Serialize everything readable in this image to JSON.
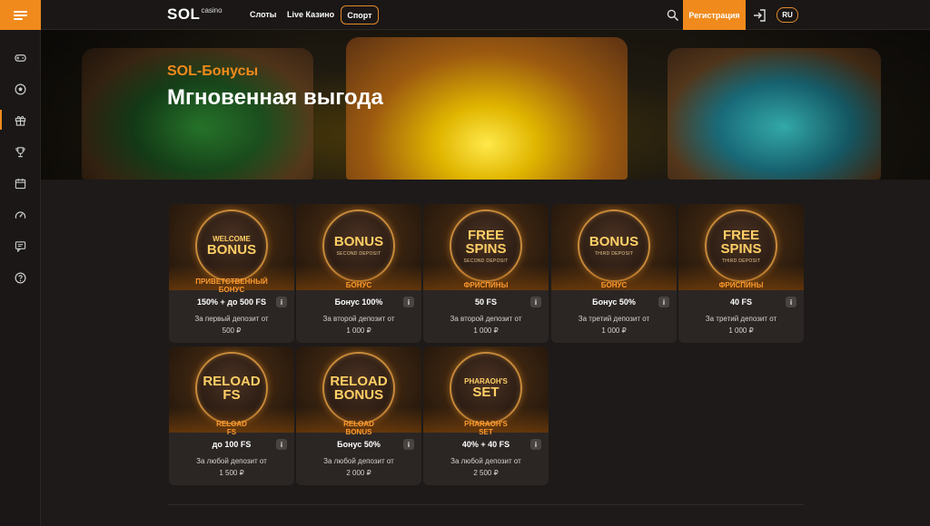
{
  "header": {
    "logo_main": "SOL",
    "logo_sub": "casino",
    "nav": [
      "Слоты",
      "Live Казино"
    ],
    "sport_label": "Спорт",
    "register_label": "Регистрация",
    "lang": "RU"
  },
  "sidebar": {
    "items": [
      {
        "icon": "gamepad-icon",
        "active": false
      },
      {
        "icon": "soccer-ball-icon",
        "active": false
      },
      {
        "icon": "gift-icon",
        "active": true
      },
      {
        "icon": "trophy-icon",
        "active": false
      },
      {
        "icon": "calendar-icon",
        "active": false
      },
      {
        "icon": "speedometer-icon",
        "active": false
      },
      {
        "icon": "chat-icon",
        "active": false
      },
      {
        "icon": "help-icon",
        "active": false
      }
    ]
  },
  "hero": {
    "subtitle": "SOL-Бонусы",
    "title": "Мгновенная выгода"
  },
  "colors": {
    "accent": "#f08a1c",
    "background": "#1d1a19",
    "card": "#2b2624"
  },
  "bonuses": [
    {
      "badge": [
        "WELCOME",
        "BONUS"
      ],
      "badge_sub": "",
      "kind": [
        "ПРИВЕТСТВЕННЫЙ",
        "БОНУС"
      ],
      "amount": "150% + до 500 FS",
      "desc": [
        "За первый депозит от",
        "500 ₽"
      ]
    },
    {
      "badge": [
        "BONUS"
      ],
      "badge_sub": "SECOND DEPOSIT",
      "kind": [
        "БОНУС"
      ],
      "amount": "Бонус 100%",
      "desc": [
        "За второй депозит от",
        "1 000 ₽"
      ]
    },
    {
      "badge": [
        "FREE",
        "SPINS"
      ],
      "badge_sub": "SECOND DEPOSIT",
      "kind": [
        "ФРИСПИНЫ"
      ],
      "amount": "50 FS",
      "desc": [
        "За второй депозит от",
        "1 000 ₽"
      ]
    },
    {
      "badge": [
        "BONUS"
      ],
      "badge_sub": "THIRD DEPOSIT",
      "kind": [
        "БОНУС"
      ],
      "amount": "Бонус 50%",
      "desc": [
        "За третий депозит от",
        "1 000 ₽"
      ]
    },
    {
      "badge": [
        "FREE",
        "SPINS"
      ],
      "badge_sub": "THIRD DEPOSIT",
      "kind": [
        "ФРИСПИНЫ"
      ],
      "amount": "40 FS",
      "desc": [
        "За третий депозит от",
        "1 000 ₽"
      ]
    },
    {
      "badge": [
        "RELOAD FS"
      ],
      "badge_sub": "",
      "kind": [
        "RELOAD",
        "FS"
      ],
      "amount": "до 100 FS",
      "desc": [
        "За любой депозит от",
        "1 500 ₽"
      ]
    },
    {
      "badge": [
        "RELOAD",
        "BONUS"
      ],
      "badge_sub": "",
      "kind": [
        "RELOAD",
        "BONUS"
      ],
      "amount": "Бонус 50%",
      "desc": [
        "За любой депозит от",
        "2 000 ₽"
      ]
    },
    {
      "badge": [
        "PHARAOH'S",
        "SET"
      ],
      "badge_sub": "",
      "kind": [
        "PHARAOH'S",
        "SET"
      ],
      "amount": "40% + 40 FS",
      "desc": [
        "За любой депозит от",
        "2 500 ₽"
      ]
    }
  ],
  "info_label": "i"
}
